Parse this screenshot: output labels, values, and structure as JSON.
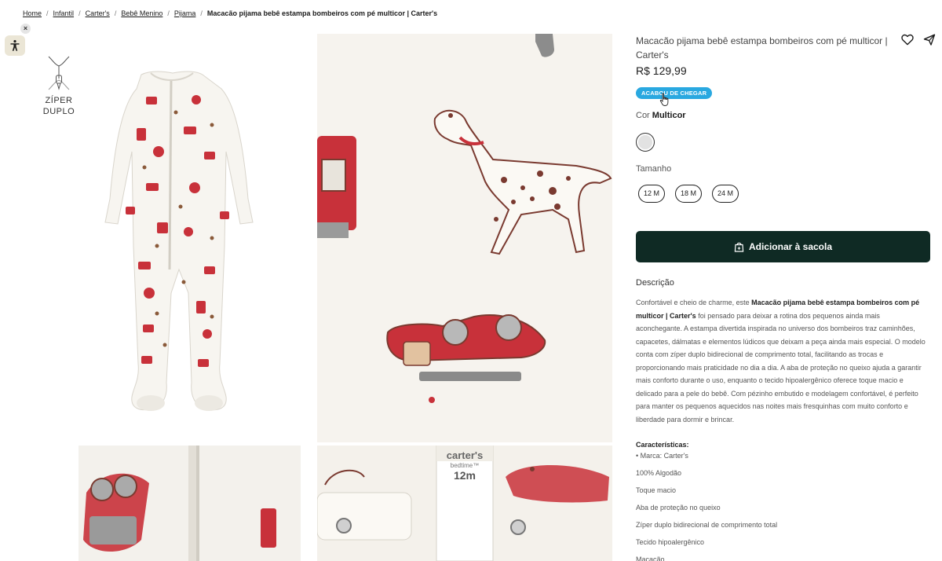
{
  "breadcrumb": {
    "items": [
      "Home",
      "Infantil",
      "Carter's",
      "Bebê Menino",
      "Pijama"
    ],
    "current": "Macacão pijama bebê estampa bombeiros com pé multicor | Carter's"
  },
  "a11y": {
    "close_label": "×"
  },
  "badge_ziper": {
    "line1": "ZÍPER",
    "line2": "DUPLO"
  },
  "product": {
    "title": "Macacão pijama bebê estampa bombeiros com pé multicor | Carter's",
    "price": "R$ 129,99",
    "badge": "ACABOU DE CHEGAR",
    "color_label": "Cor",
    "color_value": "Multicor",
    "size_label": "Tamanho",
    "sizes": [
      "12 M",
      "18 M",
      "24 M"
    ],
    "add_to_bag": "Adicionar à sacola",
    "description_title": "Descrição",
    "description_intro": "Confortável e cheio de charme, este",
    "description_bold": "Macacão pijama bebê estampa bombeiros com pé multicor | Carter's",
    "description_rest": "foi pensado para deixar a rotina dos pequenos ainda mais aconchegante. A estampa divertida inspirada no universo dos bombeiros traz caminhões, capacetes, dálmatas e elementos lúdicos que deixam a peça ainda mais especial. O modelo conta com zíper duplo bidirecional de comprimento total, facilitando as trocas e proporcionando mais praticidade no dia a dia. A aba de proteção no queixo ajuda a garantir mais conforto durante o uso, enquanto o tecido hipoalergênico oferece toque macio e delicado para a pele do bebê. Com pézinho embutido e modelagem confortável, é perfeito para manter os pequenos aquecidos nas noites mais fresquinhas com muito conforto e liberdade para dormir e brincar.",
    "features_title": "Características:",
    "features": [
      "• Marca: Carter's",
      "100% Algodão",
      "Toque macio",
      "Aba de proteção no queixo",
      "Zíper duplo bidirecional de comprimento total",
      "Tecido hipoalergênico",
      "Macacão"
    ]
  },
  "label_text": {
    "brand": "carter's",
    "line": "bedtime™",
    "size": "12m"
  },
  "colors": {
    "primary": "#0f2a24",
    "badge": "#29a8e0",
    "print_red": "#c8313a"
  }
}
